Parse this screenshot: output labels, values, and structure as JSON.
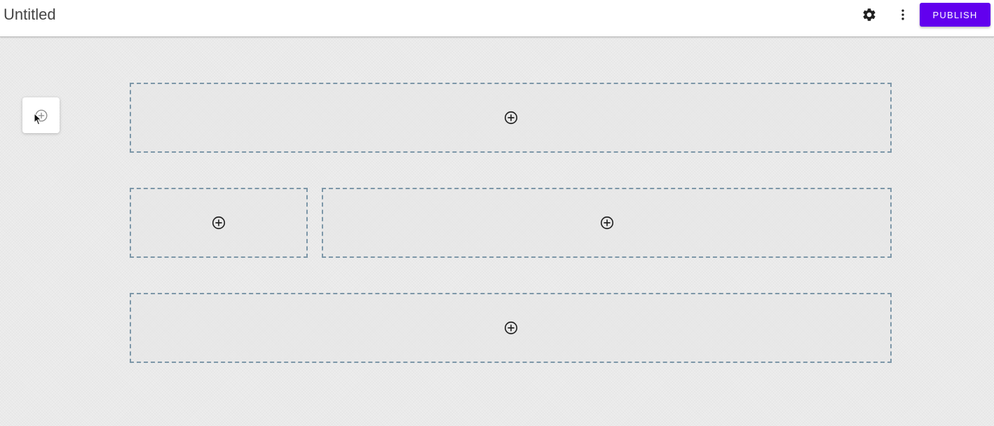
{
  "header": {
    "title": "Untitled",
    "settings_icon": "gear-icon",
    "more_icon": "more-vert-icon",
    "publish_label": "PUBLISH"
  },
  "floating_add": {
    "icon": "add-circle-icon"
  },
  "layout_zones": [
    {
      "id": "row-1-full",
      "icon": "add-circle-icon"
    },
    {
      "id": "row-2-left",
      "icon": "add-circle-icon"
    },
    {
      "id": "row-2-right",
      "icon": "add-circle-icon"
    },
    {
      "id": "row-3-full",
      "icon": "add-circle-icon"
    }
  ],
  "colors": {
    "accent": "#6200ee",
    "zone_border": "#7d97a8",
    "canvas_background": "#ededed",
    "title_text": "#444444"
  }
}
